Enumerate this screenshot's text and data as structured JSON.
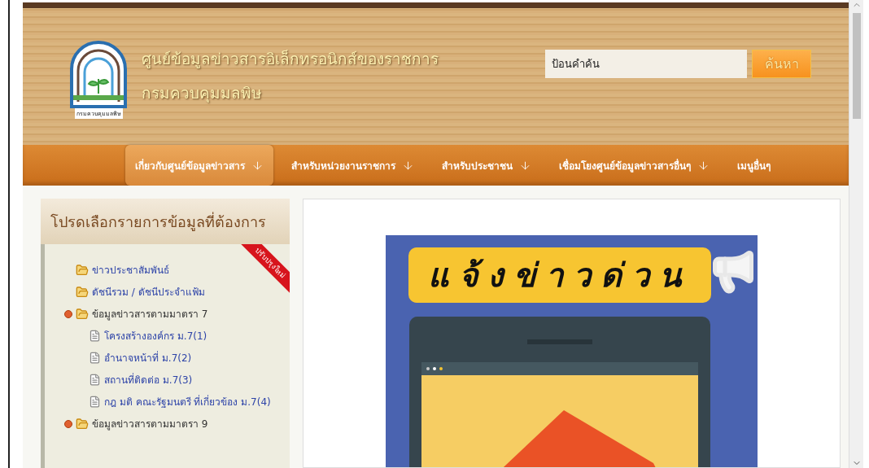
{
  "header": {
    "title_line_1": "ศูนย์ข้อมูลข่าวสารอิเล็กทรอนิกส์ของราชการ",
    "title_line_2": "กรมควบคุมมลพิษ",
    "logo_text": "กรมควบคุมมลพิษ"
  },
  "search": {
    "placeholder": "ป้อนคำค้น",
    "button": "ค้นหา"
  },
  "nav": [
    {
      "label": "เกี่ยวกับศูนย์ข้อมูลข่าวสาร",
      "has_arrow": true,
      "selected": true
    },
    {
      "label": "สำหรับหน่วยงานราชการ",
      "has_arrow": true,
      "selected": false
    },
    {
      "label": "สำหรับประชาชน",
      "has_arrow": true,
      "selected": false
    },
    {
      "label": "เชื่อมโยงศูนย์ข้อมูลข่าวสารอื่นๆ",
      "has_arrow": true,
      "selected": false
    },
    {
      "label": "เมนูอื่นๆ",
      "has_arrow": false,
      "selected": false
    }
  ],
  "sidebar": {
    "title": "โปรดเลือกรายการข้อมูลที่ต้องการ",
    "ribbon": "ปรับปรุงใหม่",
    "items": [
      {
        "kind": "folder",
        "label": "ข่าวประชาสัมพันธ์",
        "expanded": false
      },
      {
        "kind": "folder",
        "label": "ดัชนีรวม / ดัชนีประจำแฟ้ม",
        "expanded": false
      },
      {
        "kind": "folder",
        "label": "ข้อมูลข่าวสารตามมาตรา 7",
        "expanded": true,
        "children": [
          {
            "kind": "document",
            "label": "โครงสร้างองค์กร ม.7(1)"
          },
          {
            "kind": "document",
            "label": "อำนาจหน้าที่ ม.7(2)"
          },
          {
            "kind": "document",
            "label": "สถานที่ติดต่อ ม.7(3)"
          },
          {
            "kind": "document",
            "label": "กฎ มติ คณะรัฐมนตรี ที่เกี่ยวข้อง ม.7(4)"
          }
        ]
      },
      {
        "kind": "folder",
        "label": "ข้อมูลข่าวสารตามมาตรา 9",
        "expanded": true
      }
    ]
  },
  "banner": {
    "headline": "แจ้งข่าวด่วน"
  }
}
